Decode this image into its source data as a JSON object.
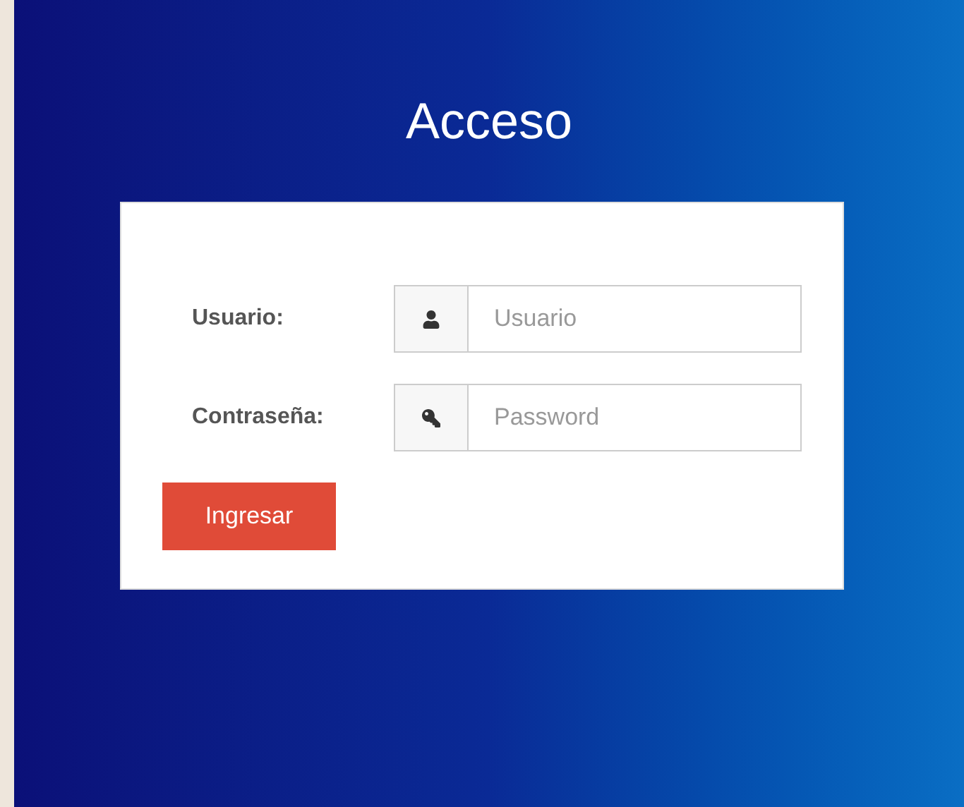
{
  "title": "Acceso",
  "fields": [
    {
      "label": "Usuario:",
      "placeholder": "Usuario",
      "kind": "user"
    },
    {
      "label": "Contraseña:",
      "placeholder": "Password",
      "kind": "key"
    }
  ],
  "button": "Ingresar"
}
